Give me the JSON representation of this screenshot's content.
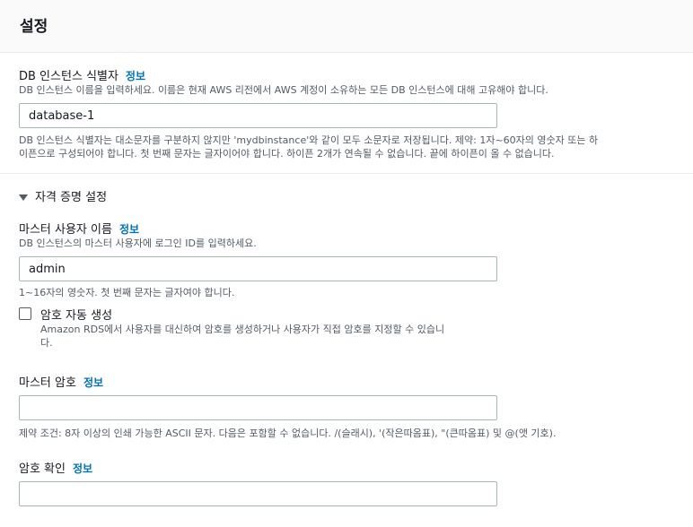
{
  "section_title": "설정",
  "info_link": "정보",
  "db_identifier": {
    "label": "DB 인스턴스 식별자",
    "description": "DB 인스턴스 이름을 입력하세요. 이름은 현재 AWS 리전에서 AWS 계정이 소유하는 모든 DB 인스턴스에 대해 고유해야 합니다.",
    "value": "database-1",
    "hint_line1": "DB 인스턴스 식별자는 대소문자를 구분하지 않지만 'mydbinstance'와 같이 모두 소문자로 저장됩니다. 제약: 1자~60자의 영숫자 또는 하",
    "hint_line2": "이픈으로 구성되어야 합니다. 첫 번째 문자는 글자이어야 합니다. 하이픈 2개가 연속될 수 없습니다. 끝에 하이픈이 올 수 없습니다."
  },
  "credentials": {
    "toggle_label": "자격 증명 설정",
    "master_username": {
      "label": "마스터 사용자 이름",
      "description": "DB 인스턴스의 마스터 사용자에 로그인 ID를 입력하세요.",
      "value": "admin",
      "hint": "1~16자의 영숫자. 첫 번째 문자는 글자여야 합니다."
    },
    "auto_generate": {
      "label": "암호 자동 생성",
      "checked": false,
      "description_line1": "Amazon RDS에서 사용자를 대신하여 암호를 생성하거나 사용자가 직접 암호를 지정할 수 있습니",
      "description_line2": "다."
    },
    "master_password": {
      "label": "마스터 암호",
      "value": "",
      "hint": "제약 조건: 8자 이상의 인쇄 가능한 ASCII 문자. 다음은 포함할 수 없습니다. /(슬래시), '(작은따옴표), \"(큰따옴표) 및 @(앳 기호)."
    },
    "confirm_password": {
      "label": "암호 확인",
      "value": ""
    }
  }
}
